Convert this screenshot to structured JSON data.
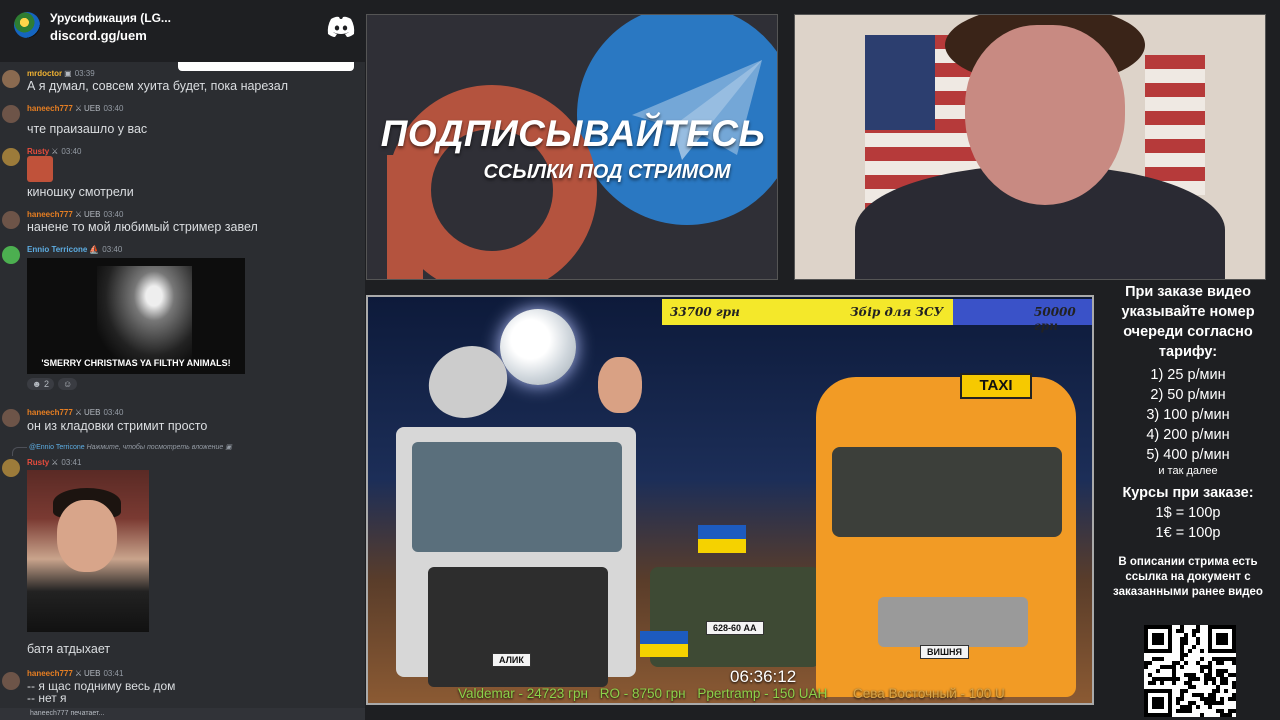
{
  "discord": {
    "server_name": "Урусификация (LG...",
    "invite_link": "discord.gg/uem",
    "messages": [
      {
        "user": "mrdoctor",
        "badge": "",
        "time": "03:39",
        "text": "А я думал, совсем хуита будет, пока нарезал"
      },
      {
        "user": "haneech777",
        "badge": "UEB",
        "time": "03:40",
        "text": "чте праизашло у вас"
      },
      {
        "user": "Rusty",
        "badge": "",
        "time": "03:40",
        "text": "киношку смотрели"
      },
      {
        "user": "haneech777",
        "badge": "UEB",
        "time": "03:40",
        "text": "нанене то мой любимый стример завел"
      },
      {
        "user": "Ennio Terricone",
        "badge": "",
        "time": "03:40",
        "text": ""
      },
      {
        "user": "haneech777",
        "badge": "UEB",
        "time": "03:40",
        "text": "он из кладовки стримит просто"
      },
      {
        "user": "Rusty",
        "badge": "",
        "time": "03:41",
        "text": "батя атдыхает"
      },
      {
        "user": "haneech777",
        "badge": "UEB",
        "time": "03:41",
        "text": "-- я щас подниму весь дом"
      }
    ],
    "gif_caption": "'SMERRY CHRISTMAS YA FILTHY ANIMALS!",
    "reaction_count": "2",
    "reply_user": "@Ennio Terricone",
    "reply_text": "Нажмите, чтобы посмотреть вложение",
    "last_line": "-- нет я",
    "typing_text": "haneech777 печатает..."
  },
  "banner": {
    "title": "ПОДПИСЫВАЙТЕСЬ",
    "subtitle": "ССЫЛКИ ПОД СТРИМОМ"
  },
  "scene": {
    "goal_current": "33700 грн",
    "goal_label": "Збір для ЗСУ",
    "goal_target": "50000 грн",
    "goal_progress": 0.674,
    "taxi_sign": "TAXI",
    "plate_left": "АЛИК",
    "plate_tank": "628-60 АА",
    "plate_van": "ВИШНЯ",
    "timer": "06:36:12",
    "ticker": [
      "Valdemar - 24723 грн",
      "RO - 8750 грн",
      "Ppertramp - 150 UAH",
      "Сева Восточный - 100 U"
    ]
  },
  "info": {
    "title": "При заказе видео указывайте номер очереди согласно тарифу:",
    "tariffs": [
      "1) 25 р/мин",
      "2) 50 р/мин",
      "3) 100 р/мин",
      "4) 200 р/мин",
      "5) 400 р/мин"
    ],
    "etc": "и так далее",
    "rates_title": "Курсы при заказе:",
    "rates": [
      "1$ = 100р",
      "1€ = 100р"
    ],
    "description": "В описании стрима есть ссылка на документ с заказанными ранее видео"
  },
  "colors": {
    "discord_bg": "#2b2d31",
    "progress_fill": "#f4e82a",
    "progress_bg": "#3a52c8",
    "van": "#f29b25",
    "ticker": "#8cd24a"
  }
}
